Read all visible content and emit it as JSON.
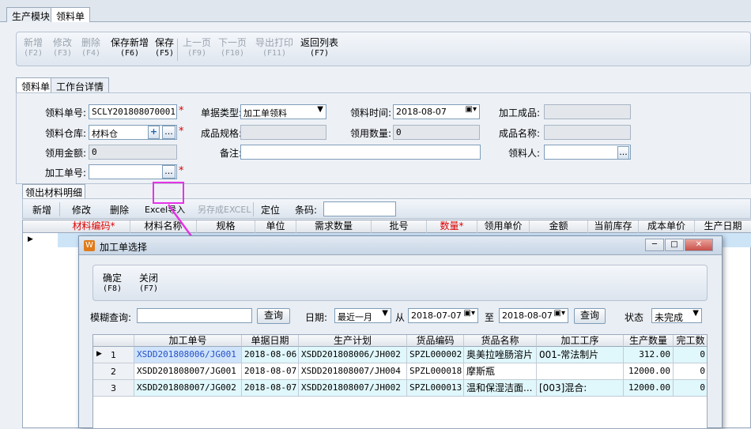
{
  "top_tabs": [
    "生产模块",
    "领料单"
  ],
  "toolbar": [
    {
      "label": "新增",
      "key": "(F2)",
      "disabled": true
    },
    {
      "label": "修改",
      "key": "(F3)",
      "disabled": true
    },
    {
      "label": "删除",
      "key": "(F4)",
      "disabled": true
    },
    {
      "label": "保存新增",
      "key": "(F6)",
      "disabled": false
    },
    {
      "label": "保存",
      "key": "(F5)",
      "disabled": false
    },
    {
      "label": "上一页",
      "key": "(F9)",
      "disabled": true
    },
    {
      "label": "下一页",
      "key": "(F10)",
      "disabled": true
    },
    {
      "label": "导出打印",
      "key": "(F11)",
      "disabled": true
    },
    {
      "label": "返回列表",
      "key": "(F7)",
      "disabled": false
    }
  ],
  "form_tabs": [
    "领料单",
    "工作台详情"
  ],
  "form": {
    "order_no_label": "领料单号:",
    "order_no": "SCLY201808070001",
    "doc_type_label": "单据类型:",
    "doc_type": "加工单领料",
    "pick_time_label": "领料时间:",
    "pick_time": "2018-08-07",
    "product_label": "加工成品:",
    "warehouse_label": "领料仓库:",
    "warehouse": "材料仓",
    "spec_label": "成品规格:",
    "qty_label": "领用数量:",
    "qty": "0",
    "product_name_label": "成品名称:",
    "amount_label": "领用金额:",
    "amount": "0",
    "remark_label": "备注:",
    "picker_label": "领料人:",
    "process_no_label": "加工单号:",
    "add_symbol": "+",
    "more_symbol": "...",
    "required_mark": "*"
  },
  "detail": {
    "tab": "领出材料明细",
    "buttons": [
      {
        "label": "新增",
        "disabled": false
      },
      {
        "label": "修改",
        "disabled": false
      },
      {
        "label": "删除",
        "disabled": false
      },
      {
        "label": "Excel导入",
        "disabled": false
      },
      {
        "label": "另存成EXCEL",
        "disabled": true
      },
      {
        "label": "定位",
        "disabled": false
      }
    ],
    "barcode_label": "条码:",
    "columns": [
      "材料编码*",
      "材料名称",
      "规格",
      "单位",
      "需求数量",
      "批号",
      "数量*",
      "领用单价",
      "金额",
      "当前库存",
      "成本单价",
      "生产日期"
    ]
  },
  "modal": {
    "title": "加工单选择",
    "window_buttons": [
      "─",
      "□",
      "✕"
    ],
    "toolbar": [
      {
        "label": "确定",
        "key": "(F8)"
      },
      {
        "label": "关闭",
        "key": "(F7)"
      }
    ],
    "fuzzy_label": "模糊查询:",
    "query_btn": "查询",
    "date_label": "日期:",
    "date_range": "最近一月",
    "from_label": "从",
    "from_date": "2018-07-07",
    "to_label": "至",
    "to_date": "2018-08-07",
    "status_label": "状态",
    "status": "未完成",
    "columns": [
      "加工单号",
      "单据日期",
      "生产计划",
      "货品编码",
      "货品名称",
      "加工工序",
      "生产数量",
      "完工数"
    ],
    "rows": [
      {
        "n": "1",
        "cells": [
          "XSDD201808006/JG001",
          "2018-08-06",
          "XSDD201808006/JH002",
          "SPZL000002",
          "奥美拉唑肠溶片",
          "001-常法制片",
          "312.00",
          "0"
        ]
      },
      {
        "n": "2",
        "cells": [
          "XSDD201808007/JG001",
          "2018-08-07",
          "XSDD201808007/JH004",
          "SPZL000018",
          "摩斯瓶",
          "",
          "12000.00",
          "0"
        ]
      },
      {
        "n": "3",
        "cells": [
          "XSDD201808007/JG002",
          "2018-08-07",
          "XSDD201808007/JH002",
          "SPZL000013",
          "温和保湿洁面...",
          "[003]混合:",
          "12000.00",
          "0"
        ]
      }
    ]
  },
  "colors": {
    "highlight": "#e633e6",
    "required": "#dd0000",
    "selected_text": "#2450c8"
  }
}
